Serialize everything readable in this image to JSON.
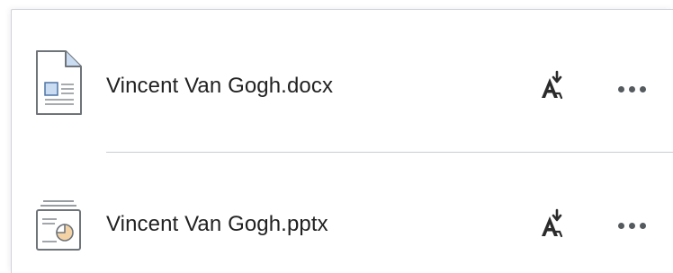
{
  "files": [
    {
      "name": "Vincent Van Gogh.docx",
      "type_icon": "word-document-icon",
      "accessibility_icon": "accessibility-download-icon",
      "menu_icon": "more-options-icon"
    },
    {
      "name": "Vincent Van Gogh.pptx",
      "type_icon": "powerpoint-presentation-icon",
      "accessibility_icon": "accessibility-download-icon",
      "menu_icon": "more-options-icon"
    }
  ],
  "colors": {
    "text": "#222222",
    "icon_dark": "#2b2b2b",
    "icon_gray": "#555a5f",
    "doc_accent": "#c9dcf2",
    "ppt_accent": "#f3d3a6",
    "divider": "#c9cdd1"
  }
}
